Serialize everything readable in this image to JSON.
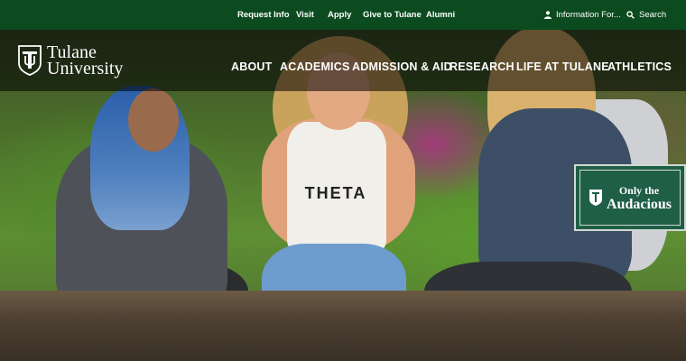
{
  "utility": {
    "links": [
      {
        "label": "Request Info"
      },
      {
        "label": "Visit"
      },
      {
        "label": "Apply"
      },
      {
        "label": "Give to Tulane"
      },
      {
        "label": "Alumni"
      }
    ],
    "info_label": "Information For...",
    "search_label": "Search"
  },
  "logo": {
    "line1": "Tulane",
    "line2": "University"
  },
  "nav": {
    "items": [
      {
        "label": "ABOUT"
      },
      {
        "label": "ACADEMICS"
      },
      {
        "label": "ADMISSION & AID"
      },
      {
        "label": "RESEARCH"
      },
      {
        "label": "LIFE AT TULANE"
      },
      {
        "label": "ATHLETICS"
      }
    ]
  },
  "hero": {
    "shirt_text": "THETA"
  },
  "badge": {
    "line1": "Only the",
    "line2": "Audacious"
  },
  "colors": {
    "utility_bg": "#0b4b1f",
    "badge_bg": "#1f5e47"
  }
}
